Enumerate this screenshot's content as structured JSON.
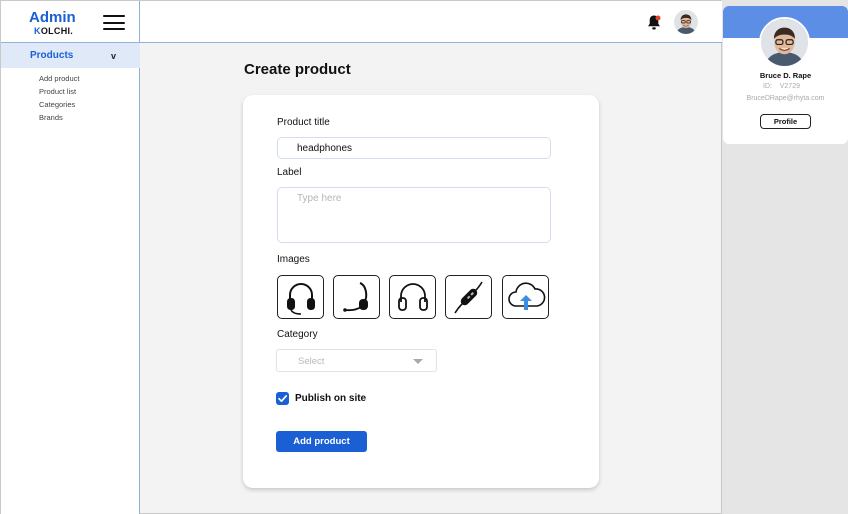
{
  "brand": {
    "title": "Admin",
    "subtitle_accent": "K",
    "subtitle_rest": "OLCHI."
  },
  "sidebar": {
    "section": {
      "label": "Products",
      "chevron": "v"
    },
    "items": [
      {
        "label": "Add product"
      },
      {
        "label": "Product list"
      },
      {
        "label": "Categories"
      },
      {
        "label": "Brands"
      }
    ]
  },
  "topbar": {
    "bell_icon": "bell-icon",
    "notification_color": "#e0452b"
  },
  "page": {
    "title": "Create product"
  },
  "form": {
    "title_label": "Product title",
    "title_value": "headphones",
    "label_label": "Label",
    "label_placeholder": "Type here",
    "images_label": "Images",
    "images": [
      {
        "icon": "headphones-over-ear-icon"
      },
      {
        "icon": "headset-single-ear-icon"
      },
      {
        "icon": "headphones-outline-icon"
      },
      {
        "icon": "inline-remote-icon"
      },
      {
        "icon": "cloud-upload-icon"
      }
    ],
    "category_label": "Category",
    "category_placeholder": "Select",
    "publish_label": "Publish on site",
    "publish_checked": true,
    "submit_label": "Add product"
  },
  "profile": {
    "name": "Bruce D. Rape",
    "id_label": "ID:",
    "id_value": "V2729",
    "email": "BruceDRape@rhyta.com",
    "button_label": "Profile"
  },
  "colors": {
    "accent": "#1a5fd4",
    "profile_band": "#5d8ee6"
  }
}
